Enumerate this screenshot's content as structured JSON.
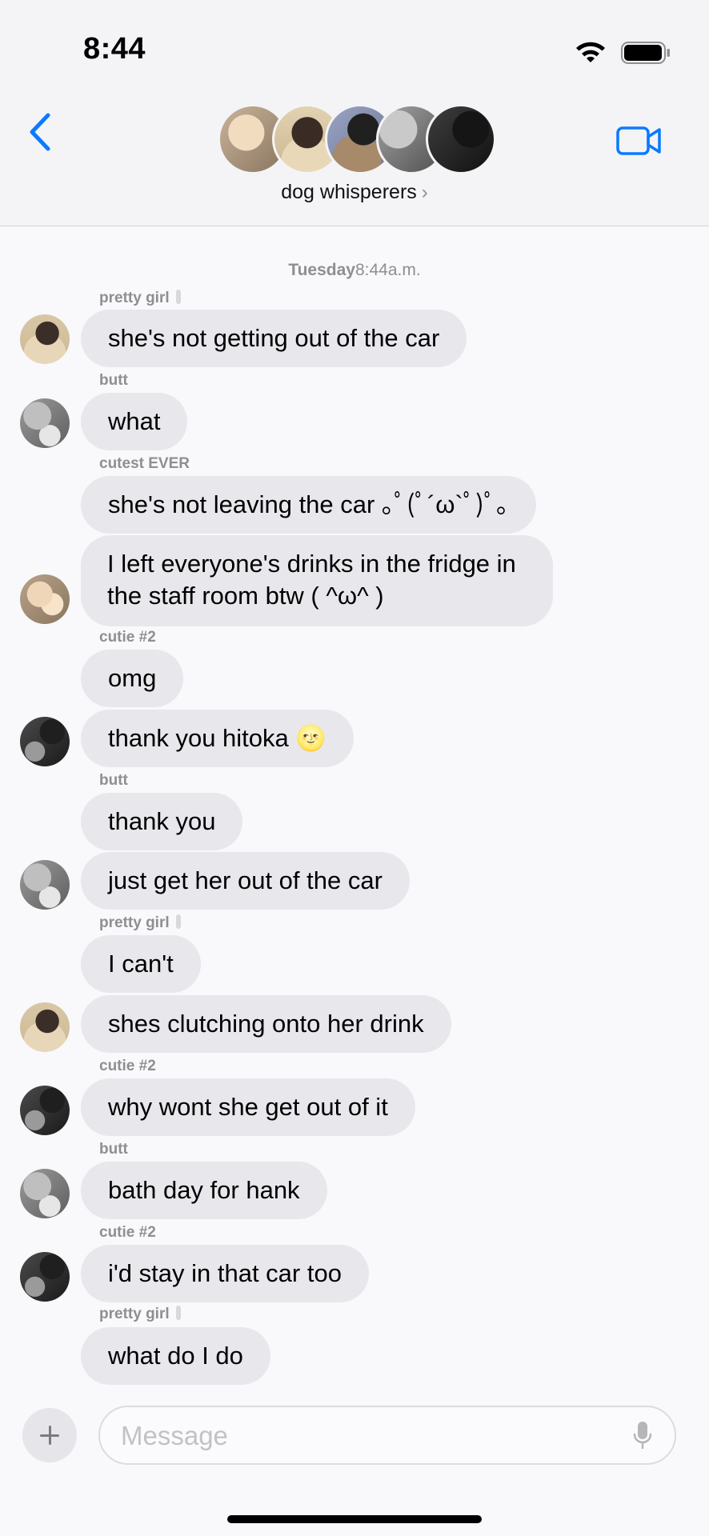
{
  "status": {
    "time": "8:44"
  },
  "header": {
    "group_name": "dog whisperers",
    "chevron": "›",
    "icons": {
      "back": "chevron-left-icon",
      "video": "video-camera-icon"
    },
    "accent_color": "#0a7aff"
  },
  "timestamp": {
    "day": "Tuesday",
    "time": "8:44a.m."
  },
  "messages": [
    {
      "sender": "pretty girl",
      "text": "she's not getting out of the car"
    },
    {
      "sender": "butt",
      "text": "what"
    },
    {
      "sender": "cutest EVER",
      "text": "she's not leaving the car ｡ﾟ(ﾟ´ω`ﾟ)ﾟ｡"
    },
    {
      "text": "I left everyone's drinks in the fridge in the staff room btw ( ^ω^ )"
    },
    {
      "sender": "cutie #2",
      "text": "omg"
    },
    {
      "text": "thank you hitoka 🌝"
    },
    {
      "sender": "butt",
      "text": "thank you"
    },
    {
      "text": "just get her out of the car"
    },
    {
      "sender": "pretty girl",
      "text": "I can't"
    },
    {
      "text": "shes clutching onto her drink"
    },
    {
      "sender": "cutie #2",
      "text": "why wont she get out of it"
    },
    {
      "sender": "butt",
      "text": "bath day for hank"
    },
    {
      "sender": "cutie #2",
      "text": "i'd stay in that car too"
    },
    {
      "sender": "pretty girl",
      "text": "what do I do"
    }
  ],
  "input": {
    "placeholder": "Message"
  },
  "colors": {
    "bubble": "#e8e7ec",
    "background": "#f9f9fb",
    "sender": "#8e8e93"
  }
}
